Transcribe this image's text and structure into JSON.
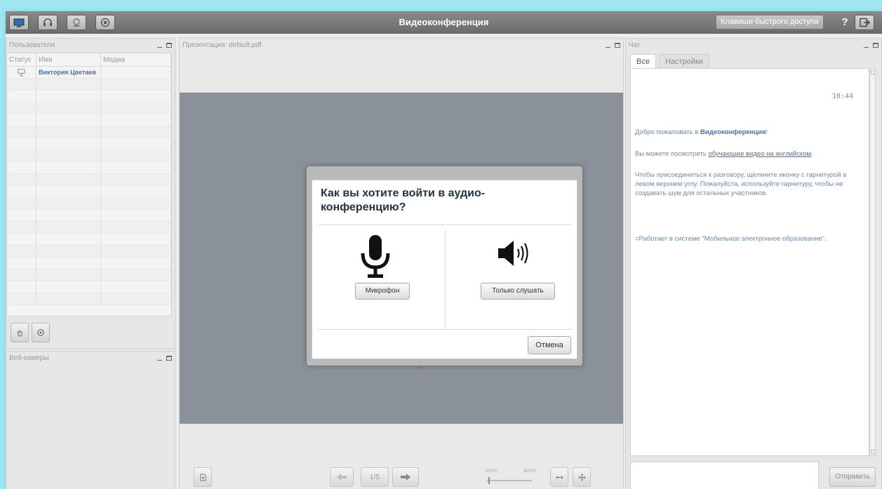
{
  "app": {
    "title": "Видеоконференция"
  },
  "topbar": {
    "shortcuts_label": "Клавиши быстрого доступа",
    "help_label": "?"
  },
  "users": {
    "title": "Пользователи",
    "columns": [
      "Статус",
      "Имя",
      "Медиа"
    ],
    "rows": [
      {
        "name": "Виктория Цветаев"
      }
    ]
  },
  "webcams": {
    "title": "Веб-камеры"
  },
  "presentation": {
    "title": "Презентация: default.pdf",
    "page_indicator": "1/5",
    "zoom_min_label": "100%",
    "zoom_max_label": "400%"
  },
  "chat": {
    "title": "Чат",
    "tabs": [
      "Все",
      "Настройки"
    ],
    "time": "10:44",
    "welcome_prefix": "Добро пожаловать в ",
    "welcome_app": "Видеоконференция",
    "welcome_suffix": "!",
    "video_prefix": "Вы можете посмотреть ",
    "video_link": "обучающие видео на английском",
    "video_suffix": ".",
    "join_text": "Чтобы присоединиться к разговору, щёлкните иконку с гарнитурой в левом верхнем углу. Пожалуйста, используйте гарнитуру, чтобы не создавать шум для остальных участников.",
    "powered_text": "=Работает в системе \"Мобильное электронное образование\".",
    "send_label": "Отправить"
  },
  "modal": {
    "question": "Как вы хотите войти в аудио-конференцию?",
    "mic_label": "Микрофон",
    "listen_label": "Только слушать",
    "cancel_label": "Отмена"
  },
  "colors": {
    "accent_blue": "#4a6fa5",
    "topbar": "#7a7a7a",
    "slide_bg": "#8a9199",
    "frame": "#9ee6f2"
  }
}
